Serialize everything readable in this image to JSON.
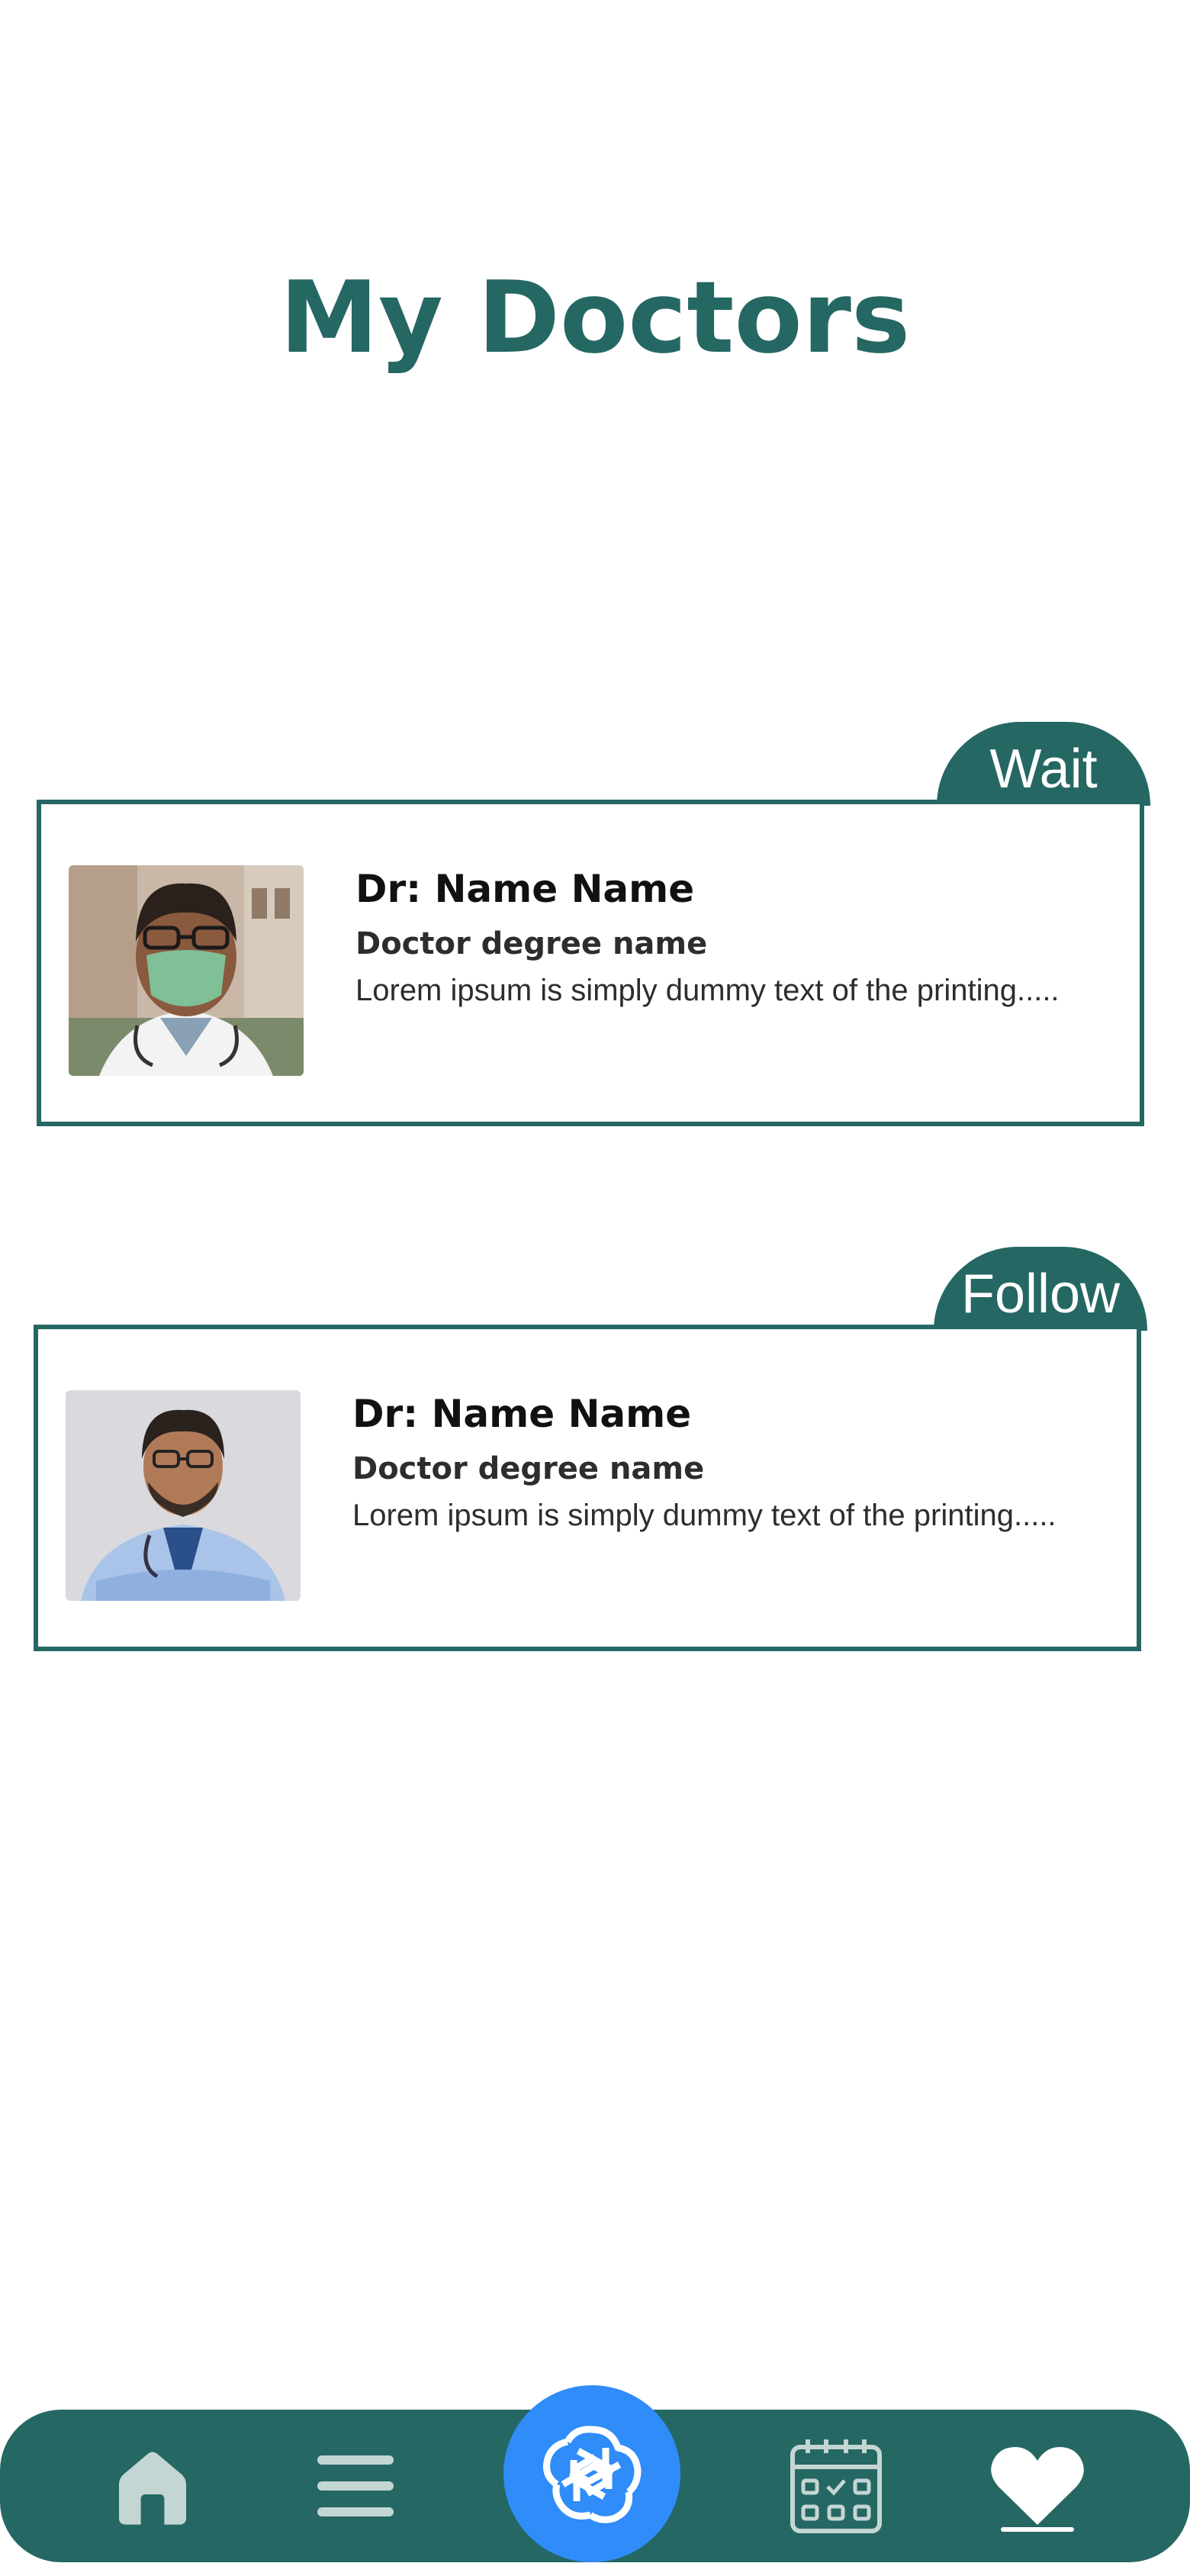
{
  "page": {
    "title": "My Doctors"
  },
  "doctors": [
    {
      "status": "Wait",
      "name": "Dr: Name Name",
      "degree": "Doctor degree name",
      "description": "Lorem ipsum is simply dummy text of the printing....."
    },
    {
      "status": "Follow",
      "name": "Dr: Name Name",
      "degree": "Doctor degree name",
      "description": "Lorem ipsum is simply dummy text of the printing....."
    }
  ],
  "nav": {
    "items": [
      "home-icon",
      "menu-icon",
      "chatbot-icon",
      "calendar-icon",
      "heart-icon"
    ],
    "active": "heart-icon"
  },
  "colors": {
    "primary": "#256763",
    "accent": "#2f8cf8",
    "text": "#2d2d2d"
  }
}
